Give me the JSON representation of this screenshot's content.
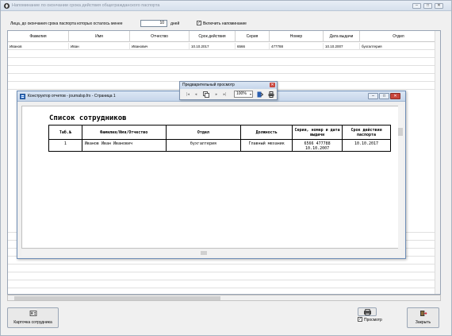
{
  "window": {
    "title": "Напоминание по окончании срока действия общегражданского паспорта",
    "controls": [
      "–",
      "□",
      "✕"
    ]
  },
  "filter": {
    "label": "Лица, до окончания срока паспорта которых осталось менее",
    "days_value": "10",
    "days_suffix": "дней",
    "notify_label": "Включить напоминание",
    "notify_checked": "✓"
  },
  "grid": {
    "columns": [
      "Фамилия",
      "Имя",
      "Отчество",
      "Срок действия",
      "Серия",
      "Номер",
      "Дата выдачи",
      "Отдел"
    ],
    "rows": [
      [
        "Иванов",
        "Иван",
        "Иванович",
        "10.10.2017",
        "6566",
        "477788",
        "10.10.2007",
        "бухгалтерия"
      ]
    ]
  },
  "buttons": {
    "employee_card": "Карточка сотрудника",
    "preview_label": "Просмотр",
    "preview_checked": "✓",
    "close": "Закрыть"
  },
  "report_window": {
    "title": "Конструктор отчетов - journalsp.frx - Страница 1",
    "controls": [
      "–",
      "□",
      "✕"
    ],
    "report_title": "Список сотрудников",
    "table": {
      "headers": [
        "Таб.№",
        "Фамилия/Имя/Отчество",
        "Отдел",
        "Должность",
        "Серия, номер и дата выдачи",
        "Срок действия паспорта"
      ],
      "rows": [
        [
          "1",
          "Иванов Иван Иванович",
          "бухгалтерия",
          "Главный механик",
          "6566 477788 10.10.2007",
          "10.10.2017"
        ]
      ]
    }
  },
  "preview_toolbar": {
    "title": "Предварительный просмотр",
    "close": "✕",
    "zoom": "100%"
  }
}
